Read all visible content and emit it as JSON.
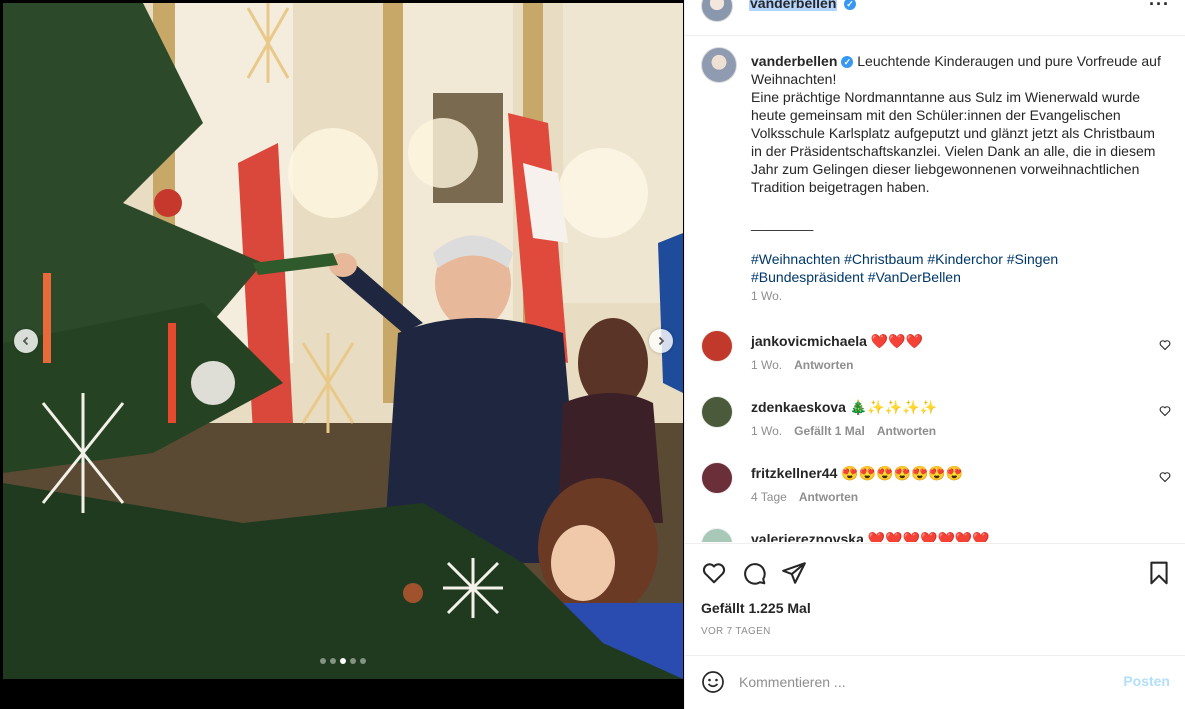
{
  "post": {
    "username": "vanderbellen",
    "caption_lead": "Leuchtende Kinderaugen und pure Vorfreude auf Weihnachten!",
    "caption_body": "Eine prächtige Nordmanntanne aus Sulz im Wienerwald wurde heute gemeinsam mit den Schüler:innen der Evangelischen Volksschule Karlsplatz aufgeputzt und glänzt jetzt als Christbaum in der Präsidentschaftskanzlei. Vielen Dank an alle, die in diesem Jahr zum Gelingen dieser liebgewonnenen vorweihnachtlichen Tradition beigetragen haben.",
    "separator": "________",
    "hashtags": "#Weihnachten #Christbaum #Kinderchor #Singen #Bundespräsident #VanDerBellen",
    "age": "1 Wo.",
    "likes": "Gefällt 1.225 Mal",
    "time_ago": "VOR 7 TAGEN",
    "carousel": {
      "count": 5,
      "active": 2
    }
  },
  "comments": [
    {
      "username": "jankovicmichaela",
      "text": "❤️❤️❤️",
      "age": "1 Wo.",
      "likes": "",
      "reply": "Antworten",
      "avatar_color": "#c0392b"
    },
    {
      "username": "zdenkaeskova",
      "text": "🎄✨✨✨✨",
      "age": "1 Wo.",
      "likes": "Gefällt 1 Mal",
      "reply": "Antworten",
      "avatar_color": "#4a5a3a"
    },
    {
      "username": "fritzkellner44",
      "text": "😍😍😍😍😍😍😍",
      "age": "4 Tage",
      "likes": "",
      "reply": "Antworten",
      "avatar_color": "#6b2f3a"
    },
    {
      "username": "valeriereznovska",
      "text": "❤️❤️❤️❤️❤️❤️❤️",
      "age": "",
      "likes": "",
      "reply": "",
      "avatar_color": "#a8c9b8"
    }
  ],
  "composer": {
    "placeholder": "Kommentieren ...",
    "post_label": "Posten"
  },
  "icons": {
    "more": "more-horizontal-icon",
    "like": "heart-icon",
    "comment": "comment-icon",
    "share": "paper-plane-icon",
    "save": "bookmark-icon",
    "emoji": "smiley-icon",
    "prev": "chevron-left-icon",
    "next": "chevron-right-icon"
  },
  "colors": {
    "hashtag": "#00376b",
    "verified": "#3897f0",
    "post_button_disabled": "#b2dffc",
    "username_highlight": "#b4d5fe"
  }
}
